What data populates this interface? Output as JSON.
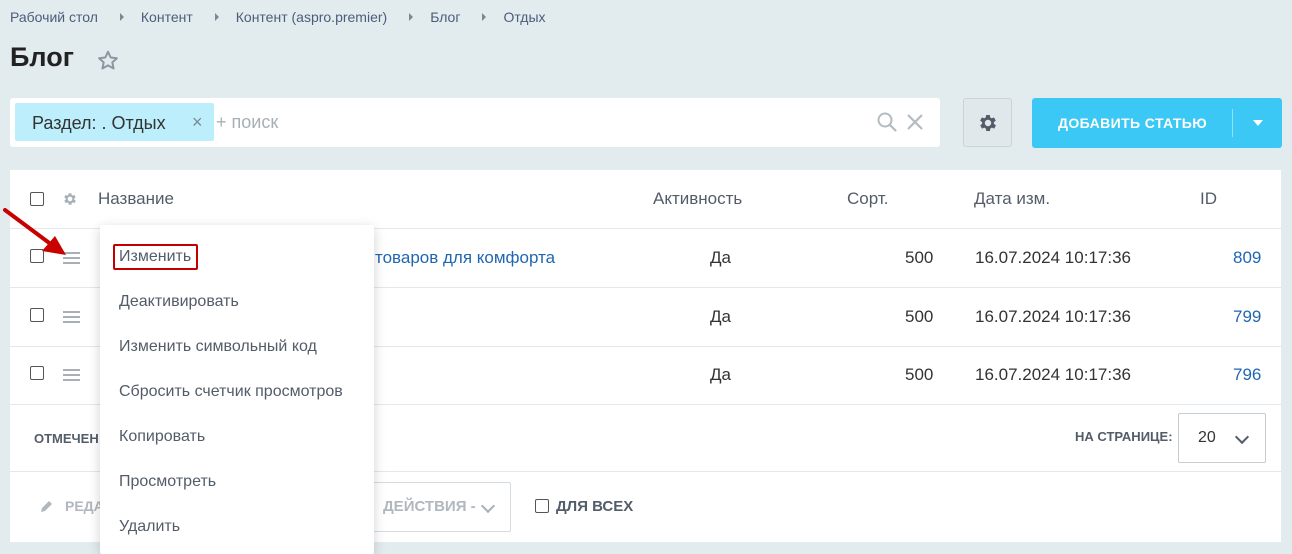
{
  "breadcrumb": [
    "Рабочий стол",
    "Контент",
    "Контент (aspro.premier)",
    "Блог",
    "Отдых"
  ],
  "page_title": "Блог",
  "filter": {
    "tag_label": "Раздел: . Отдых",
    "tag_remove": "×",
    "search_placeholder": "+ поиск"
  },
  "toolbar": {
    "add_label": "ДОБАВИТЬ СТАТЬЮ"
  },
  "table": {
    "columns": [
      "Название",
      "Активность",
      "Сорт.",
      "Дата изм.",
      "ID"
    ],
    "rows": [
      {
        "name": "товаров для комфорта",
        "active": "Да",
        "sort": "500",
        "date": "16.07.2024 10:17:36",
        "id": "809"
      },
      {
        "name": "",
        "active": "Да",
        "sort": "500",
        "date": "16.07.2024 10:17:36",
        "id": "799"
      },
      {
        "name": "",
        "active": "Да",
        "sort": "500",
        "date": "16.07.2024 10:17:36",
        "id": "796"
      }
    ]
  },
  "footer": {
    "checked_label": "ОТМЕЧЕН",
    "per_page_label": "НА СТРАНИЦЕ:",
    "per_page_value": "20",
    "edit_label": "РЕДА",
    "actions_label": "ДЕЙСТВИЯ -",
    "for_all_label": "ДЛЯ ВСЕХ"
  },
  "context_menu": {
    "items": [
      "Изменить",
      "Деактивировать",
      "Изменить символьный код",
      "Сбросить счетчик просмотров",
      "Копировать",
      "Просмотреть",
      "Удалить"
    ],
    "highlighted_item": "Изменить",
    "highlight_color": "#c30000"
  },
  "colors": {
    "accent": "#3bc8f5",
    "tag_bg": "#bdeefc",
    "link": "#2067b0",
    "annotation_arrow": "#c80000"
  }
}
